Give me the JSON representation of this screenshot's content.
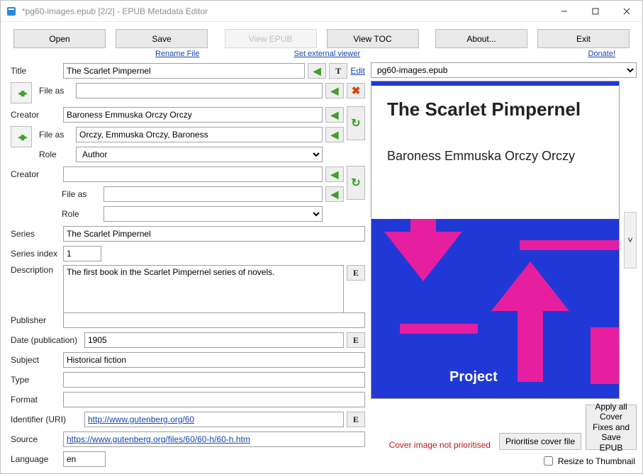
{
  "window": {
    "title": "*pg60-images.epub [2/2] - EPUB Metadata Editor"
  },
  "toolbar": {
    "open": "Open",
    "save": "Save",
    "viewEpub": "View EPUB",
    "viewToc": "View TOC",
    "about": "About...",
    "exit": "Exit",
    "renameFile": "Rename File",
    "setExternal": "Set external viewer",
    "donate": "Donate!"
  },
  "labels": {
    "title": "Title",
    "fileAs": "File as",
    "creator": "Creator",
    "role": "Role",
    "series": "Series",
    "seriesIndex": "Series index",
    "description": "Description",
    "publisher": "Publisher",
    "datePub": "Date (publication)",
    "subject": "Subject",
    "type": "Type",
    "format": "Format",
    "identifier": "Identifier (URI)",
    "source": "Source",
    "language": "Language",
    "edit": "Edit"
  },
  "icons": {
    "T": "T",
    "E": "E"
  },
  "fields": {
    "title": "The Scarlet Pimpernel",
    "titleFileAs": "",
    "creator1": "Baroness Emmuska Orczy Orczy",
    "creator1FileAs": "Orczy, Emmuska Orczy, Baroness",
    "creator1Role": "Author",
    "creator2": "",
    "creator2FileAs": "",
    "creator2Role": "",
    "series": "The Scarlet Pimpernel",
    "seriesIndex": "1",
    "description": "The first book in the Scarlet Pimpernel series of novels.",
    "publisher": "",
    "datePub": "1905",
    "subject": "Historical fiction",
    "type": "",
    "format": "",
    "identifier": "http://www.gutenberg.org/60",
    "source": "https://www.gutenberg.org/files/60/60-h/60-h.htm",
    "language": "en"
  },
  "cover": {
    "selectorValue": "pg60-images.epub",
    "title": "The Scarlet Pimpernel",
    "author": "Baroness Emmuska Orczy Orczy",
    "footer": "Project",
    "warning": "Cover image not prioritised",
    "prioritiseBtn": "Prioritise cover file",
    "applyBtn": "Apply all Cover Fixes and Save EPUB",
    "resizeChk": "Resize to Thumbnail"
  }
}
